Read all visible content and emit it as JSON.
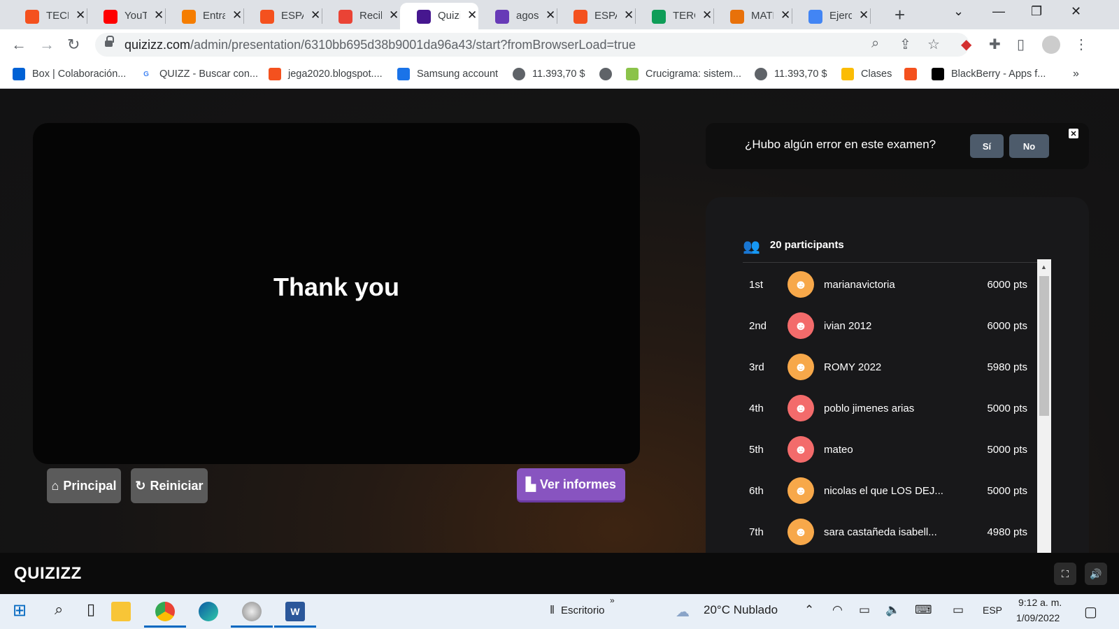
{
  "browser": {
    "tabs": [
      {
        "label": "TECNOLOGIA",
        "icon": "blogger-icon",
        "color": "#f4511e"
      },
      {
        "label": "YouTube",
        "icon": "youtube-icon",
        "color": "#ff0000"
      },
      {
        "label": "Entrada",
        "icon": "blogger-icon",
        "color": "#f57d00"
      },
      {
        "label": "ESPAÑOL",
        "icon": "blogger-icon",
        "color": "#f4511e"
      },
      {
        "label": "Recibidos",
        "icon": "gmail-icon",
        "color": "#ea4335"
      },
      {
        "label": "Quizizz",
        "icon": "quizizz-icon",
        "color": "#46178f",
        "active": true
      },
      {
        "label": "agosto",
        "icon": "forms-icon",
        "color": "#673ab7"
      },
      {
        "label": "ESPAÑOL",
        "icon": "blogger-icon",
        "color": "#f4511e"
      },
      {
        "label": "TERCERO",
        "icon": "sheets-icon",
        "color": "#0f9d58"
      },
      {
        "label": "MATEMATICAS",
        "icon": "classroom-icon",
        "color": "#e8710a"
      },
      {
        "label": "Ejercicios",
        "icon": "docs-icon",
        "color": "#4285f4"
      }
    ],
    "url_host": "quizizz.com",
    "url_path": "/admin/presentation/6310bb695d38b9001da96a43/start?fromBrowserLoad=true",
    "bookmarks": [
      {
        "label": "Box | Colaboración...",
        "icon": "box-icon",
        "color": "#0061d5"
      },
      {
        "label": "QUIZZ - Buscar con...",
        "icon": "google-icon",
        "color": "#ffffff"
      },
      {
        "label": "jega2020.blogspot....",
        "icon": "blogger-icon",
        "color": "#f4511e"
      },
      {
        "label": "Samsung account",
        "icon": "samsung-icon",
        "color": "#1a73e8"
      },
      {
        "label": "11.393,70 $",
        "icon": "globe-icon",
        "color": "#5f6368"
      },
      {
        "label": "",
        "icon": "globe-icon",
        "color": "#5f6368"
      },
      {
        "label": "Crucigrama: sistem...",
        "icon": "educaplay-icon",
        "color": "#8bc34a"
      },
      {
        "label": "11.393,70 $",
        "icon": "globe-icon",
        "color": "#5f6368"
      },
      {
        "label": "Clases",
        "icon": "classroom-icon",
        "color": "#fbbc04"
      },
      {
        "label": "",
        "icon": "blogger-icon",
        "color": "#f4511e"
      },
      {
        "label": "BlackBerry - Apps f...",
        "icon": "blackberry-icon",
        "color": "#000000"
      }
    ]
  },
  "quiz": {
    "slide_text": "Thank you",
    "buttons": {
      "principal": "Principal",
      "reiniciar": "Reiniciar",
      "reports": "Ver informes"
    },
    "error_prompt": {
      "question": "¿Hubo algún error en este examen?",
      "yes": "Sí",
      "no": "No"
    },
    "leaderboard": {
      "participants_label": "20 participants",
      "rows": [
        {
          "rank": "1st",
          "name": "marianavictoria",
          "points": "6000 pts",
          "avatar_color": "#f7a84a",
          "avatar_glyph": "☻"
        },
        {
          "rank": "2nd",
          "name": "ivian 2012",
          "points": "6000 pts",
          "avatar_color": "#f36b6b",
          "avatar_glyph": "☻"
        },
        {
          "rank": "3rd",
          "name": "ROMY 2022",
          "points": "5980 pts",
          "avatar_color": "#f7a84a",
          "avatar_glyph": "☻"
        },
        {
          "rank": "4th",
          "name": "poblo jimenes arias",
          "points": "5000 pts",
          "avatar_color": "#f36b6b",
          "avatar_glyph": "☻"
        },
        {
          "rank": "5th",
          "name": "mateo",
          "points": "5000 pts",
          "avatar_color": "#f36b6b",
          "avatar_glyph": "☻"
        },
        {
          "rank": "6th",
          "name": "nicolas el que LOS DEJ...",
          "points": "5000 pts",
          "avatar_color": "#f7a84a",
          "avatar_glyph": "☻"
        },
        {
          "rank": "7th",
          "name": "sara castañeda isabell...",
          "points": "4980 pts",
          "avatar_color": "#f7a84a",
          "avatar_glyph": "☻"
        }
      ]
    },
    "footer": {
      "logo": "QUIZIZZ"
    }
  },
  "taskbar": {
    "desktop_label": "Escritorio",
    "weather": "20°C  Nublado",
    "language": "ESP",
    "time": "9:12 a. m.",
    "date": "1/09/2022"
  }
}
